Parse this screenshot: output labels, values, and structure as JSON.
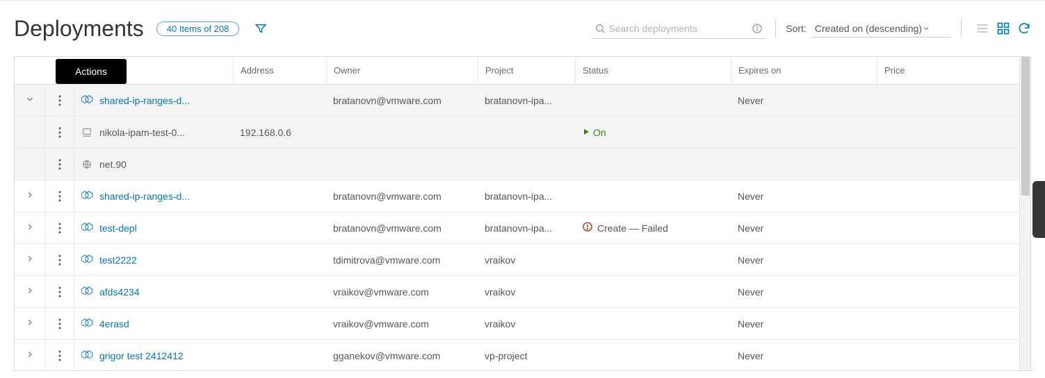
{
  "page": {
    "title": "Deployments",
    "count_label": "40 Items of 208"
  },
  "search": {
    "placeholder": "Search deployments"
  },
  "sort": {
    "label": "Sort:",
    "value": "Created on (descending)"
  },
  "tooltip": {
    "actions": "Actions"
  },
  "columns": {
    "c1": "",
    "c2": "",
    "c3": "",
    "address": "Address",
    "owner": "Owner",
    "project": "Project",
    "status": "Status",
    "expires": "Expires on",
    "price": "Price"
  },
  "rows": [
    {
      "expanded": true,
      "name": "shared-ip-ranges-d...",
      "address": "",
      "owner": "bratanovn@vmware.com",
      "project": "bratanovn-ipa...",
      "status": "",
      "expires": "Never",
      "price": "",
      "children": [
        {
          "kind": "vm",
          "name": "nikola-ipam-test-0...",
          "address": "192.168.0.6",
          "status_on": "On"
        },
        {
          "kind": "net",
          "name": "net.90",
          "address": "",
          "status_on": ""
        }
      ]
    },
    {
      "expanded": false,
      "name": "shared-ip-ranges-d...",
      "address": "",
      "owner": "bratanovn@vmware.com",
      "project": "bratanovn-ipa...",
      "status": "",
      "expires": "Never",
      "price": ""
    },
    {
      "expanded": false,
      "name": "test-depl",
      "address": "",
      "owner": "bratanovn@vmware.com",
      "project": "bratanovn-ipa...",
      "status": "Create — Failed",
      "expires": "Never",
      "price": ""
    },
    {
      "expanded": false,
      "name": "test2222",
      "address": "",
      "owner": "tdimitrova@vmware.com",
      "project": "vraikov",
      "status": "",
      "expires": "Never",
      "price": ""
    },
    {
      "expanded": false,
      "name": "afds4234",
      "address": "",
      "owner": "vraikov@vmware.com",
      "project": "vraikov",
      "status": "",
      "expires": "Never",
      "price": ""
    },
    {
      "expanded": false,
      "name": "4erasd",
      "address": "",
      "owner": "vraikov@vmware.com",
      "project": "vraikov",
      "status": "",
      "expires": "Never",
      "price": ""
    },
    {
      "expanded": false,
      "name": "grigor test 2412412",
      "address": "",
      "owner": "gganekov@vmware.com",
      "project": "vp-project",
      "status": "",
      "expires": "Never",
      "price": ""
    }
  ]
}
